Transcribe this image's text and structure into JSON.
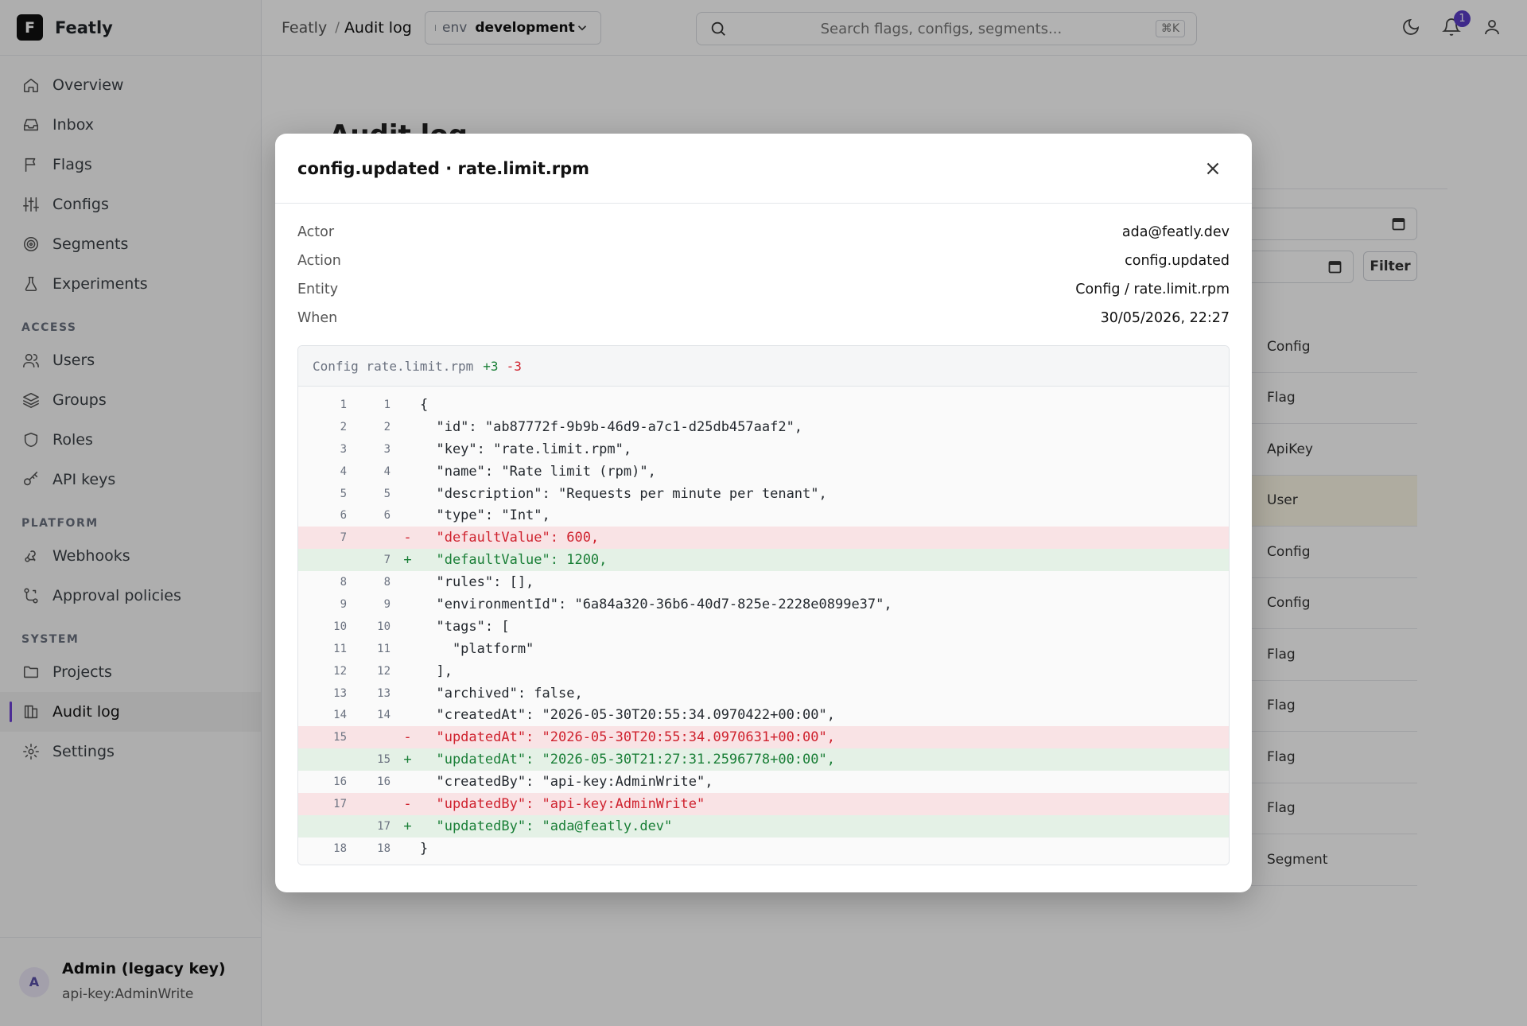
{
  "app": {
    "name": "Featly",
    "logo_letter": "F"
  },
  "sidebar": {
    "items": [
      {
        "label": "Overview",
        "icon": "home-icon"
      },
      {
        "label": "Inbox",
        "icon": "inbox-icon"
      },
      {
        "label": "Flags",
        "icon": "flag-icon"
      },
      {
        "label": "Configs",
        "icon": "sliders-icon"
      },
      {
        "label": "Segments",
        "icon": "target-icon"
      },
      {
        "label": "Experiments",
        "icon": "flask-icon"
      }
    ],
    "access_heading": "ACCESS",
    "access_items": [
      {
        "label": "Users",
        "icon": "users-icon"
      },
      {
        "label": "Groups",
        "icon": "layers-icon"
      },
      {
        "label": "Roles",
        "icon": "shield-icon"
      },
      {
        "label": "API keys",
        "icon": "key-icon"
      }
    ],
    "platform_heading": "PLATFORM",
    "platform_items": [
      {
        "label": "Webhooks",
        "icon": "webhook-icon"
      },
      {
        "label": "Approval policies",
        "icon": "workflow-icon"
      }
    ],
    "system_heading": "SYSTEM",
    "system_items": [
      {
        "label": "Projects",
        "icon": "folder-icon"
      },
      {
        "label": "Audit log",
        "icon": "log-icon",
        "active": true
      },
      {
        "label": "Settings",
        "icon": "gear-icon"
      }
    ],
    "user": {
      "avatar_letter": "A",
      "name": "Admin (legacy key)",
      "sub": "api-key:AdminWrite"
    }
  },
  "header": {
    "breadcrumb_root": "Featly",
    "breadcrumb_separator": "/",
    "breadcrumb_current": "Audit log",
    "env_label": "env",
    "env_value": "development",
    "search_placeholder": "Search flags, configs, segments...",
    "search_shortcut": "⌘K",
    "notification_count": "1"
  },
  "background": {
    "page_title": "Audit log",
    "filter_label": "Filter",
    "entity_column": [
      "Config",
      "Flag",
      "ApiKey",
      "User",
      "Config",
      "Config",
      "Flag",
      "Flag",
      "Flag",
      "Flag",
      "Segment"
    ],
    "highlighted_row": 3
  },
  "modal": {
    "title": "config.updated · rate.limit.rpm",
    "meta": [
      {
        "key": "Actor",
        "value": "ada@featly.dev"
      },
      {
        "key": "Action",
        "value": "config.updated"
      },
      {
        "key": "Entity",
        "value": "Config / rate.limit.rpm"
      },
      {
        "key": "When",
        "value": "30/05/2026, 22:27"
      }
    ],
    "diff": {
      "file": "Config rate.limit.rpm",
      "additions": "+3",
      "deletions": "-3",
      "lines": [
        {
          "type": "ctx",
          "old": "1",
          "new": "1",
          "sign": "",
          "code": "{"
        },
        {
          "type": "ctx",
          "old": "2",
          "new": "2",
          "sign": "",
          "code": "  \"id\": \"ab87772f-9b9b-46d9-a7c1-d25db457aaf2\","
        },
        {
          "type": "ctx",
          "old": "3",
          "new": "3",
          "sign": "",
          "code": "  \"key\": \"rate.limit.rpm\","
        },
        {
          "type": "ctx",
          "old": "4",
          "new": "4",
          "sign": "",
          "code": "  \"name\": \"Rate limit (rpm)\","
        },
        {
          "type": "ctx",
          "old": "5",
          "new": "5",
          "sign": "",
          "code": "  \"description\": \"Requests per minute per tenant\","
        },
        {
          "type": "ctx",
          "old": "6",
          "new": "6",
          "sign": "",
          "code": "  \"type\": \"Int\","
        },
        {
          "type": "del",
          "old": "7",
          "new": "",
          "sign": "-",
          "code": "  \"defaultValue\": 600,"
        },
        {
          "type": "add",
          "old": "",
          "new": "7",
          "sign": "+",
          "code": "  \"defaultValue\": 1200,"
        },
        {
          "type": "ctx",
          "old": "8",
          "new": "8",
          "sign": "",
          "code": "  \"rules\": [],"
        },
        {
          "type": "ctx",
          "old": "9",
          "new": "9",
          "sign": "",
          "code": "  \"environmentId\": \"6a84a320-36b6-40d7-825e-2228e0899e37\","
        },
        {
          "type": "ctx",
          "old": "10",
          "new": "10",
          "sign": "",
          "code": "  \"tags\": ["
        },
        {
          "type": "ctx",
          "old": "11",
          "new": "11",
          "sign": "",
          "code": "    \"platform\""
        },
        {
          "type": "ctx",
          "old": "12",
          "new": "12",
          "sign": "",
          "code": "  ],"
        },
        {
          "type": "ctx",
          "old": "13",
          "new": "13",
          "sign": "",
          "code": "  \"archived\": false,"
        },
        {
          "type": "ctx",
          "old": "14",
          "new": "14",
          "sign": "",
          "code": "  \"createdAt\": \"2026-05-30T20:55:34.0970422+00:00\","
        },
        {
          "type": "del",
          "old": "15",
          "new": "",
          "sign": "-",
          "code": "  \"updatedAt\": \"2026-05-30T20:55:34.0970631+00:00\","
        },
        {
          "type": "add",
          "old": "",
          "new": "15",
          "sign": "+",
          "code": "  \"updatedAt\": \"2026-05-30T21:27:31.2596778+00:00\","
        },
        {
          "type": "ctx",
          "old": "16",
          "new": "16",
          "sign": "",
          "code": "  \"createdBy\": \"api-key:AdminWrite\","
        },
        {
          "type": "del",
          "old": "17",
          "new": "",
          "sign": "-",
          "code": "  \"updatedBy\": \"api-key:AdminWrite\""
        },
        {
          "type": "add",
          "old": "",
          "new": "17",
          "sign": "+",
          "code": "  \"updatedBy\": \"ada@featly.dev\""
        },
        {
          "type": "ctx",
          "old": "18",
          "new": "18",
          "sign": "",
          "code": "}"
        }
      ]
    }
  },
  "colors": {
    "accent": "#5b3dc8",
    "diff_add_bg": "#e4f1e6",
    "diff_del_bg": "#f9e3e5",
    "add_text": "#1a7f37",
    "del_text": "#cf222e"
  }
}
